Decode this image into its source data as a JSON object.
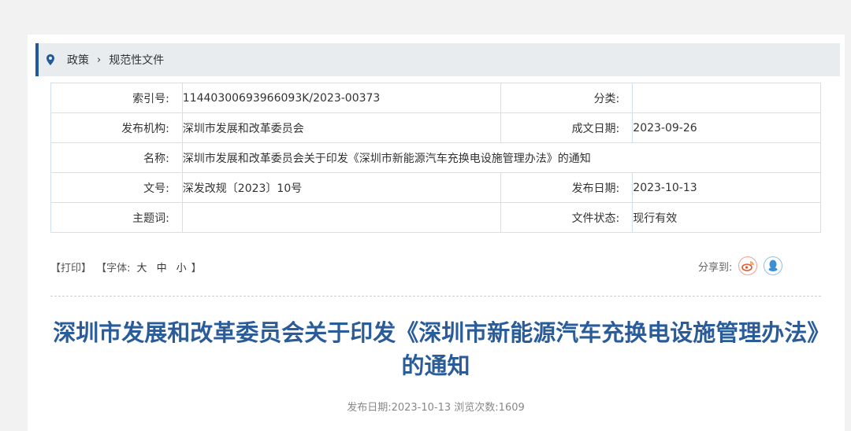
{
  "breadcrumb": {
    "items": [
      "政策",
      "规范性文件"
    ],
    "separator": "›"
  },
  "info": {
    "index_label": "索引号:",
    "index_value": "11440300693966093K/2023-00373",
    "category_label": "分类:",
    "category_value": "",
    "publisher_label": "发布机构:",
    "publisher_value": "深圳市发展和改革委员会",
    "created_label": "成文日期:",
    "created_value": "2023-09-26",
    "name_label": "名称:",
    "name_value": "深圳市发展和改革委员会关于印发《深圳市新能源汽车充换电设施管理办法》的通知",
    "docno_label": "文号:",
    "docno_value": "深发改规〔2023〕10号",
    "pubdate_label": "发布日期:",
    "pubdate_value": "2023-10-13",
    "keywords_label": "主题词:",
    "keywords_value": "",
    "status_label": "文件状态:",
    "status_value": "现行有效"
  },
  "toolbar": {
    "print": "【打印】",
    "font_prefix": "【字体:",
    "font_large": "大",
    "font_medium": "中",
    "font_small": "小",
    "font_suffix": "】"
  },
  "share": {
    "label": "分享到:",
    "weibo_icon": "weibo-icon",
    "qq_icon": "qq-icon"
  },
  "article": {
    "title": "深圳市发展和改革委员会关于印发《深圳市新能源汽车充换电设施管理办法》的通知",
    "pubdate_text": "发布日期:2023-10-13",
    "views_text": "浏览次数:1609"
  },
  "colors": {
    "accent": "#1f5a9d",
    "title": "#2a5c9a",
    "border": "#cfe0ef"
  }
}
